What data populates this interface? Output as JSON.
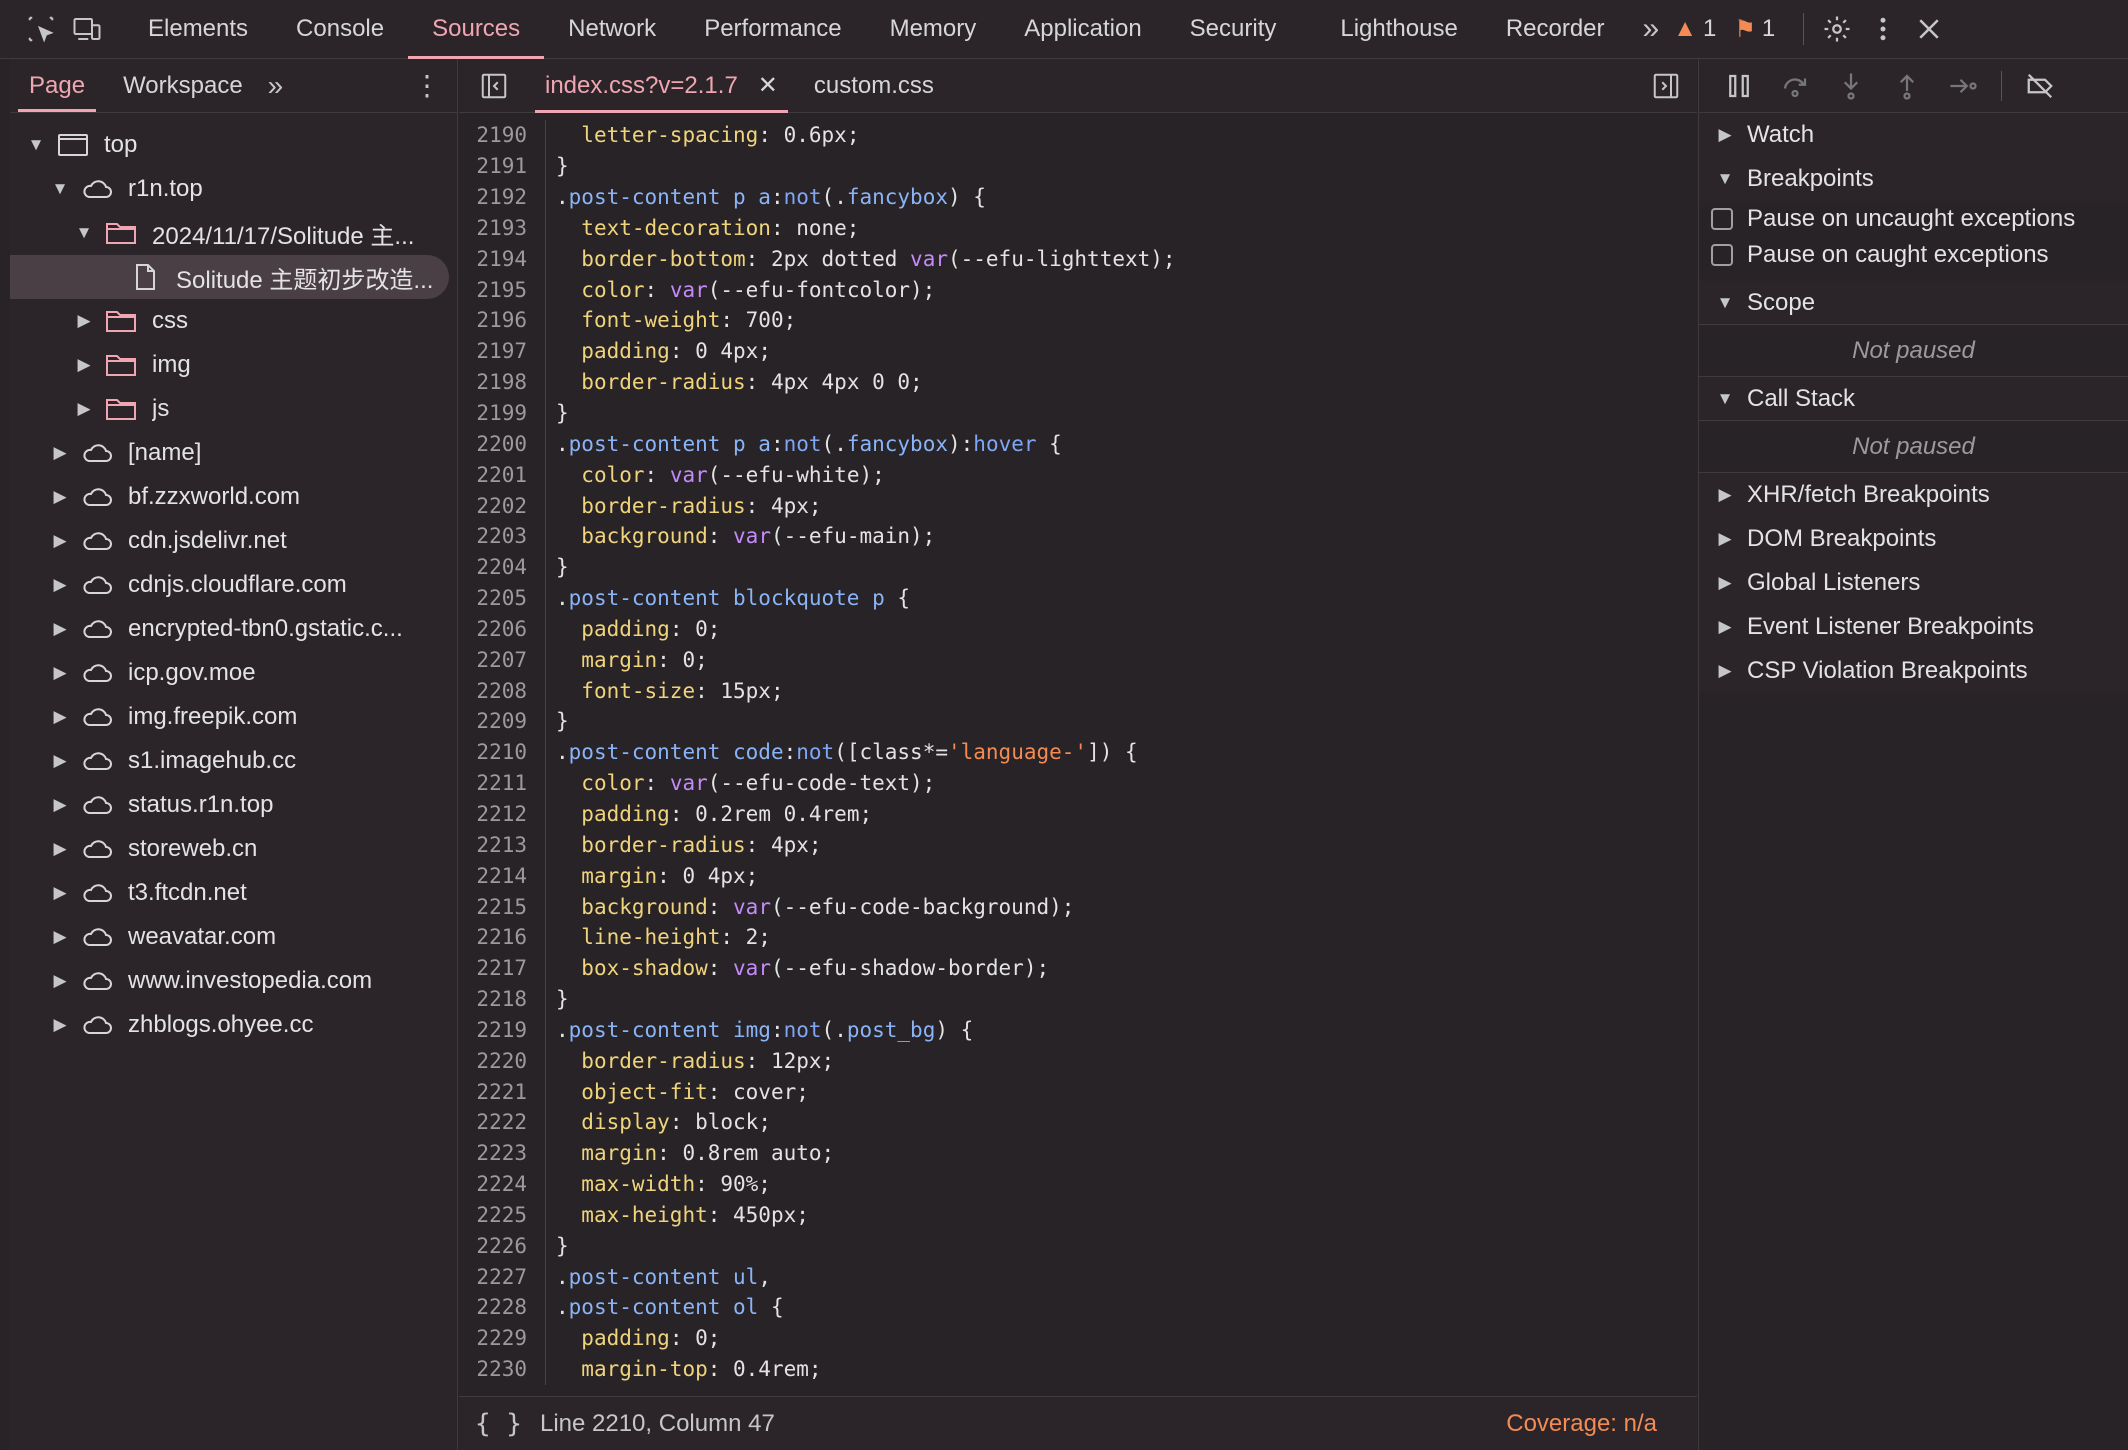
{
  "topbar": {
    "tabs": [
      "Elements",
      "Console",
      "Sources",
      "Network",
      "Performance",
      "Memory",
      "Application",
      "Security",
      "Lighthouse",
      "Recorder"
    ],
    "active_tab": "Sources",
    "warnings_count": "1",
    "issues_count": "1"
  },
  "navigator": {
    "tabs": [
      "Page",
      "Workspace"
    ],
    "active_tab": "Page",
    "tree": [
      {
        "label": "top",
        "type": "frame",
        "depth": 0,
        "expanded": true
      },
      {
        "label": "r1n.top",
        "type": "cloud",
        "depth": 1,
        "expanded": true
      },
      {
        "label": "2024/11/17/Solitude 主...",
        "type": "folder",
        "depth": 2,
        "expanded": true
      },
      {
        "label": "Solitude 主题初步改造...",
        "type": "file",
        "depth": 3,
        "selected": true
      },
      {
        "label": "css",
        "type": "folder",
        "depth": 2,
        "expanded": false
      },
      {
        "label": "img",
        "type": "folder",
        "depth": 2,
        "expanded": false
      },
      {
        "label": "js",
        "type": "folder",
        "depth": 2,
        "expanded": false
      },
      {
        "label": "[name]",
        "type": "cloud",
        "depth": 1,
        "expanded": false
      },
      {
        "label": "bf.zzxworld.com",
        "type": "cloud",
        "depth": 1,
        "expanded": false
      },
      {
        "label": "cdn.jsdelivr.net",
        "type": "cloud",
        "depth": 1,
        "expanded": false
      },
      {
        "label": "cdnjs.cloudflare.com",
        "type": "cloud",
        "depth": 1,
        "expanded": false
      },
      {
        "label": "encrypted-tbn0.gstatic.c...",
        "type": "cloud",
        "depth": 1,
        "expanded": false
      },
      {
        "label": "icp.gov.moe",
        "type": "cloud",
        "depth": 1,
        "expanded": false
      },
      {
        "label": "img.freepik.com",
        "type": "cloud",
        "depth": 1,
        "expanded": false
      },
      {
        "label": "s1.imagehub.cc",
        "type": "cloud",
        "depth": 1,
        "expanded": false
      },
      {
        "label": "status.r1n.top",
        "type": "cloud",
        "depth": 1,
        "expanded": false
      },
      {
        "label": "storeweb.cn",
        "type": "cloud",
        "depth": 1,
        "expanded": false
      },
      {
        "label": "t3.ftcdn.net",
        "type": "cloud",
        "depth": 1,
        "expanded": false
      },
      {
        "label": "weavatar.com",
        "type": "cloud",
        "depth": 1,
        "expanded": false
      },
      {
        "label": "www.investopedia.com",
        "type": "cloud",
        "depth": 1,
        "expanded": false
      },
      {
        "label": "zhblogs.ohyee.cc",
        "type": "cloud",
        "depth": 1,
        "expanded": false
      }
    ]
  },
  "editor": {
    "tabs": [
      {
        "label": "index.css?v=2.1.7",
        "active": true,
        "closable": true
      },
      {
        "label": "custom.css",
        "active": false,
        "closable": false
      }
    ],
    "lines": [
      {
        "n": "2190",
        "tokens": [
          [
            "i",
            "  "
          ],
          [
            "p",
            "letter-spacing"
          ],
          [
            "t",
            ": 0.6px;"
          ]
        ]
      },
      {
        "n": "2191",
        "tokens": [
          [
            "t",
            "}"
          ]
        ]
      },
      {
        "n": "2192",
        "tokens": [
          [
            "t",
            "."
          ],
          [
            "s",
            "post-content p a"
          ],
          [
            "t",
            ":"
          ],
          [
            "c",
            "not"
          ],
          [
            "t",
            "(."
          ],
          [
            "s",
            "fancybox"
          ],
          [
            "t",
            ") {"
          ]
        ]
      },
      {
        "n": "2193",
        "tokens": [
          [
            "i",
            "  "
          ],
          [
            "p",
            "text-decoration"
          ],
          [
            "t",
            ": none;"
          ]
        ]
      },
      {
        "n": "2194",
        "tokens": [
          [
            "i",
            "  "
          ],
          [
            "p",
            "border-bottom"
          ],
          [
            "t",
            ": 2px dotted "
          ],
          [
            "f",
            "var"
          ],
          [
            "t",
            "(--efu-lighttext);"
          ]
        ]
      },
      {
        "n": "2195",
        "tokens": [
          [
            "i",
            "  "
          ],
          [
            "p",
            "color"
          ],
          [
            "t",
            ": "
          ],
          [
            "f",
            "var"
          ],
          [
            "t",
            "(--efu-fontcolor);"
          ]
        ]
      },
      {
        "n": "2196",
        "tokens": [
          [
            "i",
            "  "
          ],
          [
            "p",
            "font-weight"
          ],
          [
            "t",
            ": 700;"
          ]
        ]
      },
      {
        "n": "2197",
        "tokens": [
          [
            "i",
            "  "
          ],
          [
            "p",
            "padding"
          ],
          [
            "t",
            ": 0 4px;"
          ]
        ]
      },
      {
        "n": "2198",
        "tokens": [
          [
            "i",
            "  "
          ],
          [
            "p",
            "border-radius"
          ],
          [
            "t",
            ": 4px 4px 0 0;"
          ]
        ]
      },
      {
        "n": "2199",
        "tokens": [
          [
            "t",
            "}"
          ]
        ]
      },
      {
        "n": "2200",
        "tokens": [
          [
            "t",
            "."
          ],
          [
            "s",
            "post-content p a"
          ],
          [
            "t",
            ":"
          ],
          [
            "c",
            "not"
          ],
          [
            "t",
            "(."
          ],
          [
            "s",
            "fancybox"
          ],
          [
            "t",
            "):"
          ],
          [
            "c",
            "hover"
          ],
          [
            "t",
            " {"
          ]
        ]
      },
      {
        "n": "2201",
        "tokens": [
          [
            "i",
            "  "
          ],
          [
            "p",
            "color"
          ],
          [
            "t",
            ": "
          ],
          [
            "f",
            "var"
          ],
          [
            "t",
            "(--efu-white);"
          ]
        ]
      },
      {
        "n": "2202",
        "tokens": [
          [
            "i",
            "  "
          ],
          [
            "p",
            "border-radius"
          ],
          [
            "t",
            ": 4px;"
          ]
        ]
      },
      {
        "n": "2203",
        "tokens": [
          [
            "i",
            "  "
          ],
          [
            "p",
            "background"
          ],
          [
            "t",
            ": "
          ],
          [
            "f",
            "var"
          ],
          [
            "t",
            "(--efu-main);"
          ]
        ]
      },
      {
        "n": "2204",
        "tokens": [
          [
            "t",
            "}"
          ]
        ]
      },
      {
        "n": "2205",
        "tokens": [
          [
            "t",
            "."
          ],
          [
            "s",
            "post-content blockquote p"
          ],
          [
            "t",
            " {"
          ]
        ]
      },
      {
        "n": "2206",
        "tokens": [
          [
            "i",
            "  "
          ],
          [
            "p",
            "padding"
          ],
          [
            "t",
            ": 0;"
          ]
        ]
      },
      {
        "n": "2207",
        "tokens": [
          [
            "i",
            "  "
          ],
          [
            "p",
            "margin"
          ],
          [
            "t",
            ": 0;"
          ]
        ]
      },
      {
        "n": "2208",
        "tokens": [
          [
            "i",
            "  "
          ],
          [
            "p",
            "font-size"
          ],
          [
            "t",
            ": 15px;"
          ]
        ]
      },
      {
        "n": "2209",
        "tokens": [
          [
            "t",
            "}"
          ]
        ]
      },
      {
        "n": "2210",
        "tokens": [
          [
            "t",
            "."
          ],
          [
            "s",
            "post-content code"
          ],
          [
            "t",
            ":"
          ],
          [
            "c",
            "not"
          ],
          [
            "t",
            "([class*="
          ],
          [
            "r",
            "'language-'"
          ],
          [
            "t",
            "]) {"
          ]
        ]
      },
      {
        "n": "2211",
        "tokens": [
          [
            "i",
            "  "
          ],
          [
            "p",
            "color"
          ],
          [
            "t",
            ": "
          ],
          [
            "f",
            "var"
          ],
          [
            "t",
            "(--efu-code-text);"
          ]
        ]
      },
      {
        "n": "2212",
        "tokens": [
          [
            "i",
            "  "
          ],
          [
            "p",
            "padding"
          ],
          [
            "t",
            ": 0.2rem 0.4rem;"
          ]
        ]
      },
      {
        "n": "2213",
        "tokens": [
          [
            "i",
            "  "
          ],
          [
            "p",
            "border-radius"
          ],
          [
            "t",
            ": 4px;"
          ]
        ]
      },
      {
        "n": "2214",
        "tokens": [
          [
            "i",
            "  "
          ],
          [
            "p",
            "margin"
          ],
          [
            "t",
            ": 0 4px;"
          ]
        ]
      },
      {
        "n": "2215",
        "tokens": [
          [
            "i",
            "  "
          ],
          [
            "p",
            "background"
          ],
          [
            "t",
            ": "
          ],
          [
            "f",
            "var"
          ],
          [
            "t",
            "(--efu-code-background);"
          ]
        ]
      },
      {
        "n": "2216",
        "tokens": [
          [
            "i",
            "  "
          ],
          [
            "p",
            "line-height"
          ],
          [
            "t",
            ": 2;"
          ]
        ]
      },
      {
        "n": "2217",
        "tokens": [
          [
            "i",
            "  "
          ],
          [
            "p",
            "box-shadow"
          ],
          [
            "t",
            ": "
          ],
          [
            "f",
            "var"
          ],
          [
            "t",
            "(--efu-shadow-border);"
          ]
        ]
      },
      {
        "n": "2218",
        "tokens": [
          [
            "t",
            "}"
          ]
        ]
      },
      {
        "n": "2219",
        "tokens": [
          [
            "t",
            "."
          ],
          [
            "s",
            "post-content img"
          ],
          [
            "t",
            ":"
          ],
          [
            "c",
            "not"
          ],
          [
            "t",
            "(."
          ],
          [
            "s",
            "post_bg"
          ],
          [
            "t",
            ") {"
          ]
        ]
      },
      {
        "n": "2220",
        "tokens": [
          [
            "i",
            "  "
          ],
          [
            "p",
            "border-radius"
          ],
          [
            "t",
            ": 12px;"
          ]
        ]
      },
      {
        "n": "2221",
        "tokens": [
          [
            "i",
            "  "
          ],
          [
            "p",
            "object-fit"
          ],
          [
            "t",
            ": cover;"
          ]
        ]
      },
      {
        "n": "2222",
        "tokens": [
          [
            "i",
            "  "
          ],
          [
            "p",
            "display"
          ],
          [
            "t",
            ": block;"
          ]
        ]
      },
      {
        "n": "2223",
        "tokens": [
          [
            "i",
            "  "
          ],
          [
            "p",
            "margin"
          ],
          [
            "t",
            ": 0.8rem auto;"
          ]
        ]
      },
      {
        "n": "2224",
        "tokens": [
          [
            "i",
            "  "
          ],
          [
            "p",
            "max-width"
          ],
          [
            "t",
            ": 90%;"
          ]
        ]
      },
      {
        "n": "2225",
        "tokens": [
          [
            "i",
            "  "
          ],
          [
            "p",
            "max-height"
          ],
          [
            "t",
            ": 450px;"
          ]
        ]
      },
      {
        "n": "2226",
        "tokens": [
          [
            "t",
            "}"
          ]
        ]
      },
      {
        "n": "2227",
        "tokens": [
          [
            "t",
            "."
          ],
          [
            "s",
            "post-content ul"
          ],
          [
            "t",
            ","
          ]
        ]
      },
      {
        "n": "2228",
        "tokens": [
          [
            "t",
            "."
          ],
          [
            "s",
            "post-content ol"
          ],
          [
            "t",
            " {"
          ]
        ]
      },
      {
        "n": "2229",
        "tokens": [
          [
            "i",
            "  "
          ],
          [
            "p",
            "padding"
          ],
          [
            "t",
            ": 0;"
          ]
        ]
      },
      {
        "n": "2230",
        "tokens": [
          [
            "i",
            "  "
          ],
          [
            "p",
            "margin-top"
          ],
          [
            "t",
            ": 0.4rem;"
          ]
        ]
      }
    ]
  },
  "statusbar": {
    "braces": "{ }",
    "position": "Line 2210, Column 47",
    "coverage": "Coverage: n/a"
  },
  "debugger": {
    "watch": "Watch",
    "breakpoints": "Breakpoints",
    "pause_uncaught": "Pause on uncaught exceptions",
    "pause_caught": "Pause on caught exceptions",
    "scope": "Scope",
    "scope_status": "Not paused",
    "call_stack": "Call Stack",
    "call_stack_status": "Not paused",
    "more_sections": [
      "XHR/fetch Breakpoints",
      "DOM Breakpoints",
      "Global Listeners",
      "Event Listener Breakpoints",
      "CSP Violation Breakpoints"
    ]
  },
  "colors": {
    "accent": "#f0a6b2",
    "background": "#282326",
    "selector": "#8ab4f8",
    "property": "#f0d47c",
    "function": "#c58af9",
    "string": "#f28b54",
    "warning": "#f28b54"
  }
}
